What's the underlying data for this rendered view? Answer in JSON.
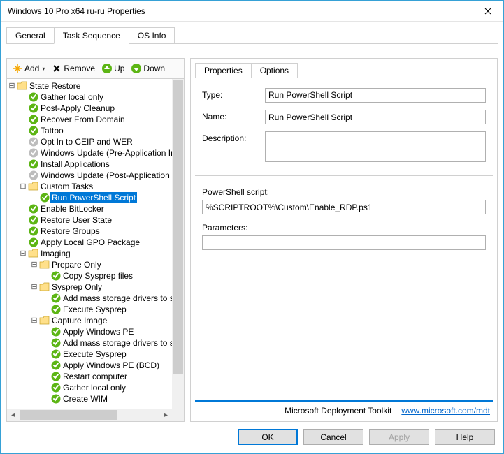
{
  "window": {
    "title": "Windows 10 Pro x64 ru-ru Properties"
  },
  "main_tabs": {
    "general": "General",
    "task_sequence": "Task Sequence",
    "os_info": "OS Info"
  },
  "toolbar": {
    "add": "Add",
    "remove": "Remove",
    "up": "Up",
    "down": "Down"
  },
  "tree": {
    "root": "State Restore",
    "items": [
      "Gather local only",
      "Post-Apply Cleanup",
      "Recover From Domain",
      "Tattoo",
      "Opt In to CEIP and WER",
      "Windows Update (Pre-Application Installation)",
      "Install Applications",
      "Windows Update (Post-Application Installation)"
    ],
    "custom_tasks": "Custom Tasks",
    "run_ps": "Run PowerShell Script",
    "after_custom": [
      "Enable BitLocker",
      "Restore User State",
      "Restore Groups",
      "Apply Local GPO Package"
    ],
    "imaging": "Imaging",
    "prepare_only": "Prepare Only",
    "prepare_items": [
      "Copy Sysprep files"
    ],
    "sysprep_only": "Sysprep Only",
    "sysprep_items": [
      "Add mass storage drivers to sysprep",
      "Execute Sysprep"
    ],
    "capture_image": "Capture Image",
    "capture_items": [
      "Apply Windows PE",
      "Add mass storage drivers to sysprep",
      "Execute Sysprep",
      "Apply Windows PE (BCD)",
      "Restart computer",
      "Gather local only",
      "Create WIM"
    ]
  },
  "right_tabs": {
    "properties": "Properties",
    "options": "Options"
  },
  "form": {
    "type_label": "Type:",
    "type_value": "Run PowerShell Script",
    "name_label": "Name:",
    "name_value": "Run PowerShell Script",
    "desc_label": "Description:",
    "desc_value": "",
    "script_label": "PowerShell script:",
    "script_value": "%SCRIPTROOT%\\Custom\\Enable_RDP.ps1",
    "params_label": "Parameters:",
    "params_value": ""
  },
  "footer": {
    "product": "Microsoft Deployment Toolkit",
    "link": "www.microsoft.com/mdt"
  },
  "buttons": {
    "ok": "OK",
    "cancel": "Cancel",
    "apply": "Apply",
    "help": "Help"
  }
}
